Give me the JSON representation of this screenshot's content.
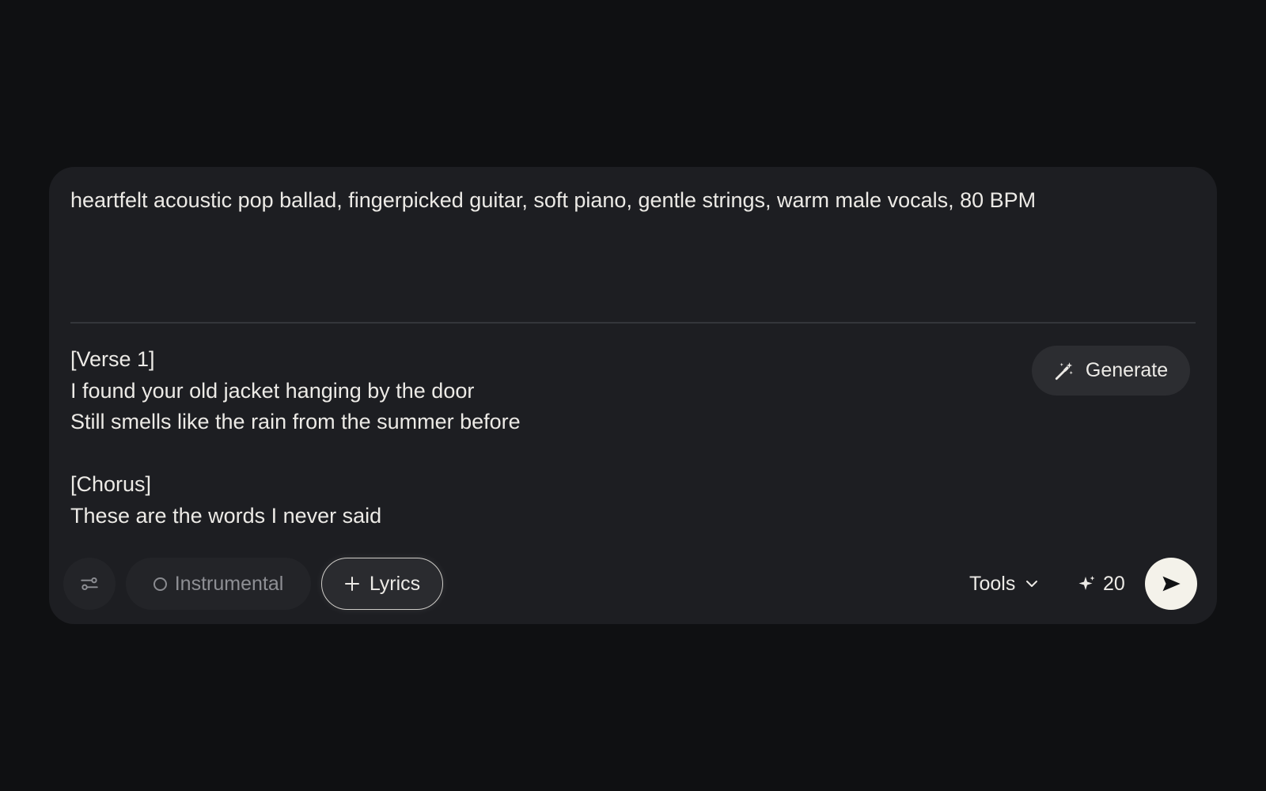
{
  "composer": {
    "style_prompt": "heartfelt acoustic pop ballad, fingerpicked guitar, soft piano, gentle strings, warm male vocals, 80 BPM",
    "lyrics": "[Verse 1]\nI found your old jacket hanging by the door\nStill smells like the rain from the summer before\n\n[Chorus]\nThese are the words I never said",
    "generate_label": "Generate"
  },
  "toolbar": {
    "settings_icon": "sliders-icon",
    "instrumental_label": "Instrumental",
    "lyrics_label": "Lyrics",
    "tools_label": "Tools",
    "credits_count": "20",
    "send_icon": "send-icon"
  },
  "colors": {
    "background": "#0f1012",
    "panel": "#1d1e22",
    "send_button": "#f4f2ea",
    "text": "#eceae6",
    "muted_text": "#8e8f94"
  }
}
